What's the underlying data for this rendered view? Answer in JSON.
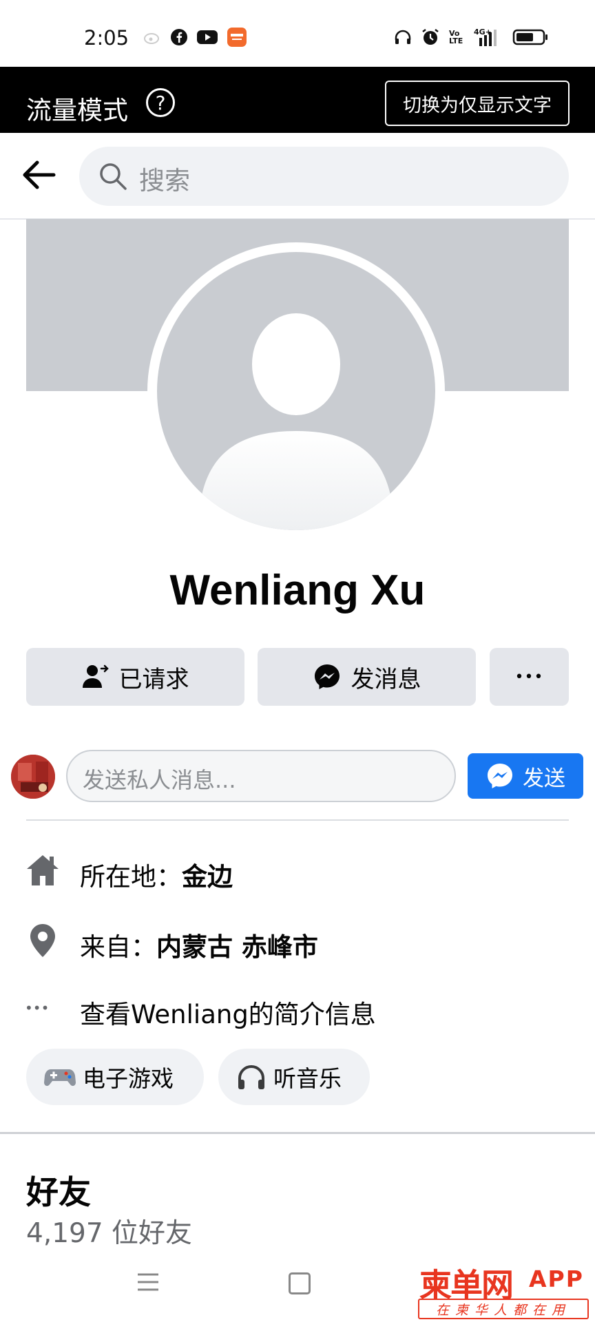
{
  "status_bar": {
    "time": "2:05",
    "icons": [
      "weibo-icon",
      "facebook-icon",
      "youtube-icon",
      "app-icon",
      "headphones-icon",
      "alarm-icon",
      "volte-icon",
      "4g-signal-icon",
      "battery-icon"
    ],
    "volte_text": "Vo LTE",
    "network_text": "4G+"
  },
  "mode_banner": {
    "title": "流量模式",
    "help_symbol": "?",
    "switch_label": "切换为仅显示文字"
  },
  "search": {
    "placeholder": "搜索"
  },
  "profile": {
    "name": "Wenliang Xu"
  },
  "actions": {
    "requested_label": "已请求",
    "message_label": "发消息",
    "more_symbol": "•••"
  },
  "composer": {
    "placeholder": "发送私人消息...",
    "send_label": "发送"
  },
  "info": {
    "location_prefix": "所在地：",
    "location_value": "金边",
    "from_prefix": "来自：",
    "from_value": "内蒙古 赤峰市",
    "about_text": "查看Wenliang的简介信息",
    "more_dots": "•••"
  },
  "hobbies": [
    {
      "icon": "gamepad-icon",
      "label": "电子游戏"
    },
    {
      "icon": "headphones-icon",
      "label": "听音乐"
    }
  ],
  "friends": {
    "title": "好友",
    "count_text": "4,197 位好友"
  },
  "watermark": {
    "logo": "柬单网",
    "app": "APP",
    "slogan": "在柬华人都在用"
  },
  "colors": {
    "accent": "#1877f2",
    "banner_bg": "#000000",
    "button_bg": "#e4e6eb",
    "placeholder_gray": "#c9ccd1",
    "watermark_red": "#e8351f"
  }
}
